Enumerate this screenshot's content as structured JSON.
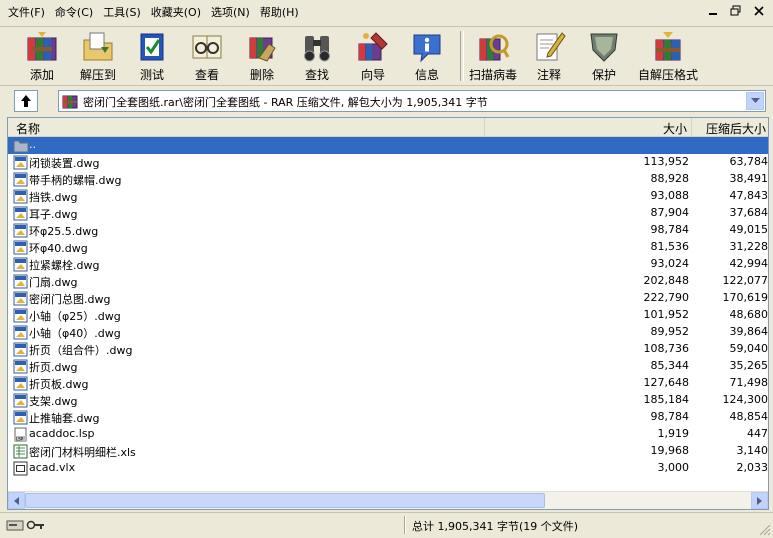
{
  "menubar": {
    "items": [
      "文件(F)",
      "命令(C)",
      "工具(S)",
      "收藏夹(O)",
      "选项(N)",
      "帮助(H)"
    ]
  },
  "toolbar": {
    "buttons": [
      {
        "label": "添加",
        "icon": "add-books-icon"
      },
      {
        "label": "解压到",
        "icon": "extract-folder-icon"
      },
      {
        "label": "测试",
        "icon": "test-check-icon"
      },
      {
        "label": "查看",
        "icon": "view-glasses-icon"
      },
      {
        "label": "删除",
        "icon": "delete-icon"
      },
      {
        "label": "查找",
        "icon": "find-binoculars-icon"
      },
      {
        "label": "向导",
        "icon": "wizard-icon"
      },
      {
        "label": "信息",
        "icon": "info-icon"
      },
      {
        "label": "扫描病毒",
        "icon": "virus-scan-icon"
      },
      {
        "label": "注释",
        "icon": "comment-pen-icon"
      },
      {
        "label": "保护",
        "icon": "shield-icon"
      },
      {
        "label": "自解压格式",
        "icon": "sfx-box-icon"
      }
    ]
  },
  "address": {
    "path": "密闭门全套图纸.rar\\密闭门全套图纸 - RAR 压缩文件, 解包大小为 1,905,341 字节"
  },
  "columns": {
    "name": "名称",
    "size": "大小",
    "packed": "压缩后大小"
  },
  "files": [
    {
      "name": "..",
      "size": "",
      "packed": "",
      "type": "folder",
      "selected": true
    },
    {
      "name": "闭锁装置.dwg",
      "size": "113,952",
      "packed": "63,784",
      "type": "dwg"
    },
    {
      "name": "带手柄的螺帽.dwg",
      "size": "88,928",
      "packed": "38,491",
      "type": "dwg"
    },
    {
      "name": "挡铁.dwg",
      "size": "93,088",
      "packed": "47,843",
      "type": "dwg"
    },
    {
      "name": "耳子.dwg",
      "size": "87,904",
      "packed": "37,684",
      "type": "dwg"
    },
    {
      "name": "环φ25.5.dwg",
      "size": "98,784",
      "packed": "49,015",
      "type": "dwg"
    },
    {
      "name": "环φ40.dwg",
      "size": "81,536",
      "packed": "31,228",
      "type": "dwg"
    },
    {
      "name": "拉紧螺栓.dwg",
      "size": "93,024",
      "packed": "42,994",
      "type": "dwg"
    },
    {
      "name": "门扇.dwg",
      "size": "202,848",
      "packed": "122,077",
      "type": "dwg"
    },
    {
      "name": "密闭门总图.dwg",
      "size": "222,790",
      "packed": "170,619",
      "type": "dwg"
    },
    {
      "name": "小轴（φ25）.dwg",
      "size": "101,952",
      "packed": "48,680",
      "type": "dwg"
    },
    {
      "name": "小轴（φ40）.dwg",
      "size": "89,952",
      "packed": "39,864",
      "type": "dwg"
    },
    {
      "name": "折页（组合件）.dwg",
      "size": "108,736",
      "packed": "59,040",
      "type": "dwg"
    },
    {
      "name": "折页.dwg",
      "size": "85,344",
      "packed": "35,265",
      "type": "dwg"
    },
    {
      "name": "折页板.dwg",
      "size": "127,648",
      "packed": "71,498",
      "type": "dwg"
    },
    {
      "name": "支架.dwg",
      "size": "185,184",
      "packed": "124,300",
      "type": "dwg"
    },
    {
      "name": "止推轴套.dwg",
      "size": "98,784",
      "packed": "48,854",
      "type": "dwg"
    },
    {
      "name": "acaddoc.lsp",
      "size": "1,919",
      "packed": "447",
      "type": "lsp"
    },
    {
      "name": "密闭门材料明细栏.xls",
      "size": "19,968",
      "packed": "3,140",
      "type": "xls"
    },
    {
      "name": "acad.vlx",
      "size": "3,000",
      "packed": "2,033",
      "type": "vlx"
    }
  ],
  "status": {
    "text": "总计 1,905,341 字节(19 个文件)"
  },
  "colors": {
    "selection": "#316ac5",
    "background": "#ece9d8"
  }
}
